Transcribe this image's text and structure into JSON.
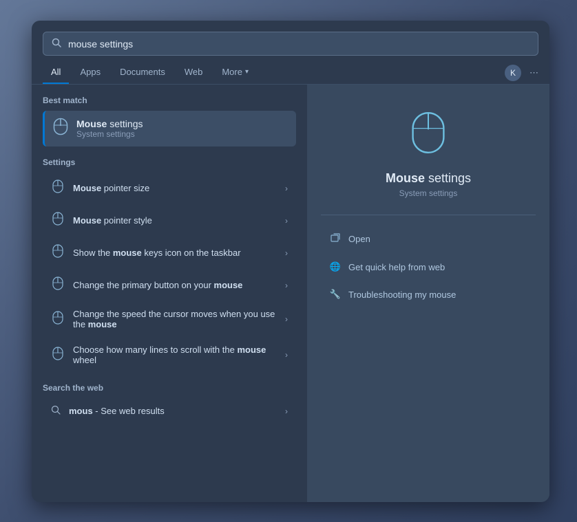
{
  "search": {
    "placeholder": "mouse settings",
    "value": "mouse settings"
  },
  "nav": {
    "tabs": [
      {
        "id": "all",
        "label": "All",
        "active": true
      },
      {
        "id": "apps",
        "label": "Apps",
        "active": false
      },
      {
        "id": "documents",
        "label": "Documents",
        "active": false
      },
      {
        "id": "web",
        "label": "Web",
        "active": false
      },
      {
        "id": "more",
        "label": "More",
        "active": false
      }
    ],
    "user_badge": "K",
    "more_icon": "⋯"
  },
  "best_match": {
    "section_label": "Best match",
    "title_prefix": "",
    "title_highlight": "Mouse",
    "title_suffix": " settings",
    "subtitle": "System settings"
  },
  "settings": {
    "section_label": "Settings",
    "items": [
      {
        "title_prefix": "",
        "title_highlight": "Mouse",
        "title_suffix": " pointer size",
        "full_text": "Mouse pointer size"
      },
      {
        "title_prefix": "",
        "title_highlight": "Mouse",
        "title_suffix": " pointer style",
        "full_text": "Mouse pointer style"
      },
      {
        "title_prefix": "Show the ",
        "title_highlight": "mouse",
        "title_suffix": " keys icon on the taskbar",
        "full_text": "Show the mouse keys icon on the taskbar"
      },
      {
        "title_prefix": "Change the primary button on your ",
        "title_highlight": "mouse",
        "title_suffix": "",
        "full_text": "Change the primary button on your mouse"
      },
      {
        "title_prefix": "Change the speed the cursor moves when you use the ",
        "title_highlight": "mouse",
        "title_suffix": "",
        "full_text": "Change the speed the cursor moves when you use the mouse"
      },
      {
        "title_prefix": "Choose how many lines to scroll with the ",
        "title_highlight": "mouse",
        "title_suffix": " wheel",
        "full_text": "Choose how many lines to scroll with the mouse wheel"
      }
    ]
  },
  "web_search": {
    "section_label": "Search the web",
    "items": [
      {
        "prefix": "mous",
        "suffix": " - See web results",
        "full_text": "mous - See web results"
      }
    ]
  },
  "right_panel": {
    "app_title_prefix": "",
    "app_title_highlight": "Mouse",
    "app_title_suffix": " settings",
    "app_subtitle": "System settings",
    "actions": [
      {
        "icon": "open",
        "label": "Open"
      },
      {
        "icon": "web",
        "label": "Get quick help from web"
      },
      {
        "icon": "trouble",
        "label": "Troubleshooting my mouse"
      }
    ]
  }
}
